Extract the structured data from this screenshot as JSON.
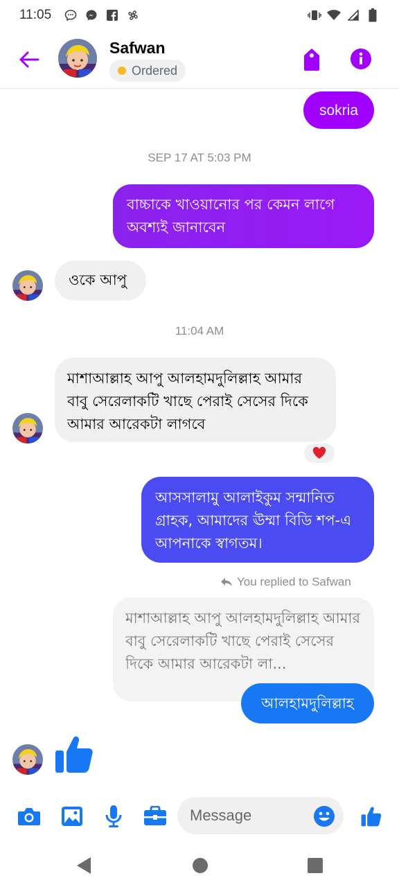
{
  "status_bar": {
    "time": "11:05"
  },
  "header": {
    "contact_name": "Safwan",
    "status_badge": "Ordered"
  },
  "colors": {
    "accent_purple": "#a100ff",
    "outgoing_blue": "#4a4bf1",
    "messenger_blue": "#1877f2",
    "incoming_gray": "#f0f0f0",
    "badge_dot": "#f7b928"
  },
  "messages": [
    {
      "direction": "out",
      "text": "sokria"
    },
    {
      "type": "timestamp",
      "text": "SEP 17 AT 5:03 PM"
    },
    {
      "direction": "out",
      "text": "বাচ্চাকে খাওয়ানোর পর কেমন লাগে অবশ্যই জানাবেন"
    },
    {
      "direction": "in",
      "text": "ওকে আপু"
    },
    {
      "type": "timestamp",
      "text": "11:04 AM"
    },
    {
      "direction": "in",
      "text": "মাশাআল্লাহ আপু আলহামদুলিল্লাহ আমার বাবু সেরেলাকটি খাছে পেরাই সেসের দিকে আমার আরেকটা লাগবে",
      "reaction": "heart"
    },
    {
      "direction": "out",
      "text": "আসসালামু আলাইকুম সন্মানিত গ্রাহক, আমাদের ঊম্মা বিডি শপ-এ  আপনাকে স্বাগতম।"
    },
    {
      "type": "reply_label",
      "text": "You replied to Safwan"
    },
    {
      "type": "quoted",
      "text": "মাশাআল্লাহ আপু আলহামদুলিল্লাহ আমার বাবু সেরেলাকটি খাছে পেরাই সেসের দিকে আমার আরেকটা লা..."
    },
    {
      "direction": "out",
      "text": "আলহামদুলিল্লাহ"
    },
    {
      "direction": "in",
      "type": "like_sticker",
      "icon": "thumbs-up-icon"
    }
  ],
  "composer": {
    "placeholder": "Message",
    "icons": [
      "camera-icon",
      "gallery-icon",
      "microphone-icon",
      "briefcase-icon",
      "emoji-icon",
      "thumbs-up-icon"
    ]
  },
  "navbar": {
    "icons": [
      "back-triangle-icon",
      "home-circle-icon",
      "recents-square-icon"
    ]
  }
}
